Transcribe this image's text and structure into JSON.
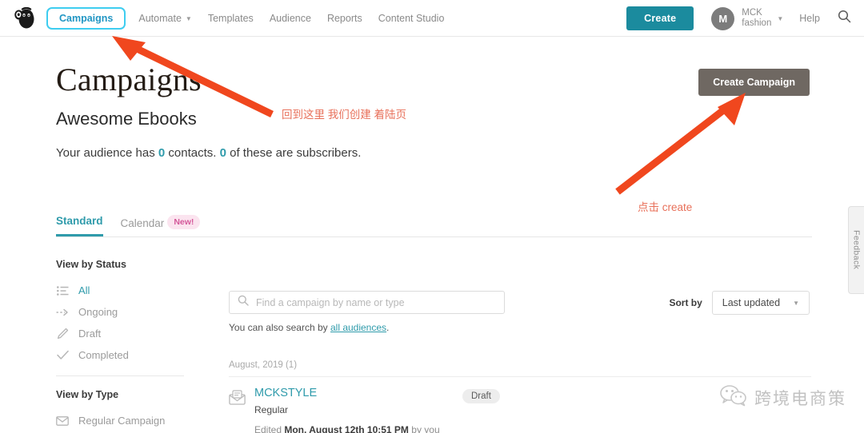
{
  "topnav": {
    "logo_icon": "mailchimp-freddie-logo",
    "items": [
      {
        "label": "Campaigns",
        "active": true,
        "has_caret": false
      },
      {
        "label": "Automate",
        "active": false,
        "has_caret": true
      },
      {
        "label": "Templates",
        "active": false,
        "has_caret": false
      },
      {
        "label": "Audience",
        "active": false,
        "has_caret": false
      },
      {
        "label": "Reports",
        "active": false,
        "has_caret": false
      },
      {
        "label": "Content Studio",
        "active": false,
        "has_caret": false
      }
    ],
    "create_label": "Create",
    "avatar_initial": "M",
    "account_line1": "MCK",
    "account_line2": "fashion",
    "help_label": "Help",
    "search_icon": "search-icon",
    "create_button_color": "#1b8b9e",
    "active_tab_border_color": "#3ecdf0"
  },
  "page": {
    "title": "Campaigns",
    "subtitle": "Awesome Ebooks",
    "audience_prefix": "Your audience has ",
    "contacts_count": "0",
    "audience_mid": " contacts. ",
    "subscribers_count": "0",
    "audience_suffix": " of these are subscribers.",
    "create_campaign_label": "Create Campaign",
    "create_campaign_color": "#6f6862"
  },
  "tabs": [
    {
      "label": "Standard",
      "active": true,
      "badge": ""
    },
    {
      "label": "Calendar",
      "active": false,
      "badge": "New!"
    }
  ],
  "sidebar": {
    "status_header": "View by Status",
    "status_items": [
      {
        "label": "All",
        "icon": "list-icon",
        "active": true
      },
      {
        "label": "Ongoing",
        "icon": "dashed-arrow-icon",
        "active": false
      },
      {
        "label": "Draft",
        "icon": "pencil-icon",
        "active": false
      },
      {
        "label": "Completed",
        "icon": "check-icon",
        "active": false
      }
    ],
    "type_header": "View by Type",
    "type_items": [
      {
        "label": "Regular Campaign",
        "icon": "envelope-icon",
        "active": false
      }
    ]
  },
  "search": {
    "placeholder": "Find a campaign by name or type",
    "value": "",
    "icon": "search-icon",
    "sub_prefix": "You can also search by ",
    "sub_link": "all audiences",
    "sub_suffix": "."
  },
  "sort": {
    "label": "Sort by",
    "selected": "Last updated",
    "caret_icon": "chevron-down-icon"
  },
  "list": {
    "month_header": "August, 2019 (1)",
    "rows": [
      {
        "icon": "open-envelope-icon",
        "name": "MCKSTYLE",
        "type": "Regular",
        "edited_prefix": "Edited ",
        "edited_date": "Mon, August 12th 10:51 PM",
        "edited_suffix": " by you",
        "status": "Draft"
      }
    ]
  },
  "feedback": {
    "label": "Feedback"
  },
  "annotations": [
    {
      "id": "anno1",
      "text": "回到这里 我们创建 着陆页",
      "color": "#e8705a"
    },
    {
      "id": "anno2",
      "text": "点击 create",
      "color": "#e8705a"
    }
  ],
  "watermark": {
    "icon": "wechat-icon",
    "text": "跨境电商策"
  }
}
